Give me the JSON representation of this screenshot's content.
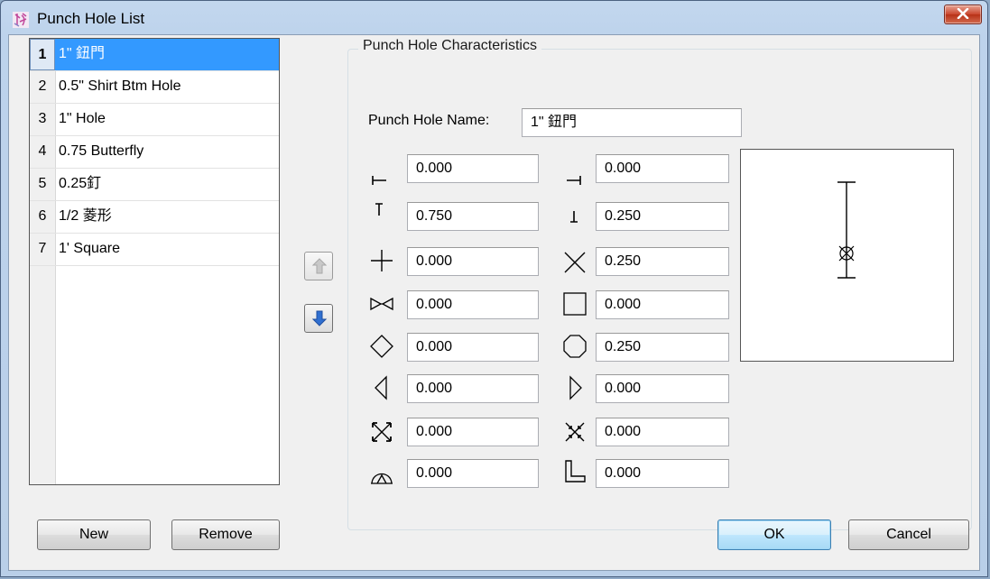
{
  "window": {
    "title": "Punch Hole List",
    "close_label": "x"
  },
  "list": {
    "items": [
      {
        "num": "1",
        "label": "1\" 鈕門"
      },
      {
        "num": "2",
        "label": "0.5\" Shirt Btm Hole"
      },
      {
        "num": "3",
        "label": "1\" Hole"
      },
      {
        "num": "4",
        "label": "0.75 Butterfly"
      },
      {
        "num": "5",
        "label": "0.25釘"
      },
      {
        "num": "6",
        "label": "1/2 菱形"
      },
      {
        "num": "7",
        "label": "1' Square"
      }
    ],
    "selected_index": 0
  },
  "buttons": {
    "new": "New",
    "remove": "Remove",
    "ok": "OK",
    "cancel": "Cancel"
  },
  "characteristics": {
    "group_title": "Punch Hole Characteristics",
    "name_label": "Punch Hole Name:",
    "name_value": "1\" 鈕門",
    "left_fields": [
      {
        "icon": "left-tick-icon",
        "value": "0.000"
      },
      {
        "icon": "top-tick-icon",
        "value": "0.750"
      },
      {
        "icon": "plus-cross-icon",
        "value": "0.000"
      },
      {
        "icon": "bowtie-icon",
        "value": "0.000"
      },
      {
        "icon": "diamond-icon",
        "value": "0.000"
      },
      {
        "icon": "left-triangle-icon",
        "value": "0.000"
      },
      {
        "icon": "x-arrows-out-icon",
        "value": "0.000"
      },
      {
        "icon": "arc-triangle-icon",
        "value": "0.000"
      }
    ],
    "right_fields": [
      {
        "icon": "right-tick-icon",
        "value": "0.000"
      },
      {
        "icon": "bottom-tick-icon",
        "value": "0.250"
      },
      {
        "icon": "x-cross-icon",
        "value": "0.250"
      },
      {
        "icon": "square-icon",
        "value": "0.000"
      },
      {
        "icon": "octagon-icon",
        "value": "0.250"
      },
      {
        "icon": "right-triangle-icon",
        "value": "0.000"
      },
      {
        "icon": "x-arrows-in-icon",
        "value": "0.000"
      },
      {
        "icon": "l-shape-icon",
        "value": "0.000"
      }
    ]
  },
  "colors": {
    "selection": "#3399ff",
    "title_bar": "#bdd3ec",
    "close_button": "#c9452d"
  }
}
